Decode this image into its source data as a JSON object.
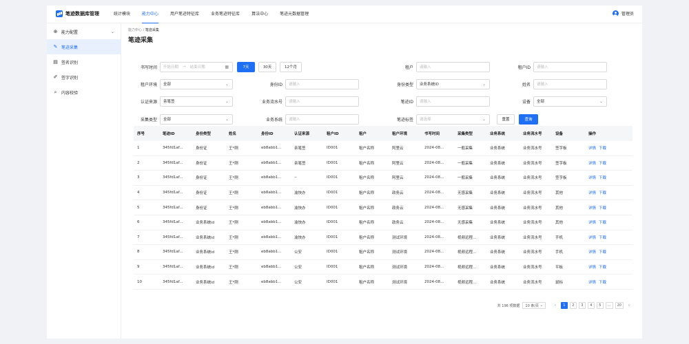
{
  "app": {
    "title": "笔迹数据库管理"
  },
  "nav": [
    {
      "label": "统计模块",
      "active": false
    },
    {
      "label": "能力中心",
      "active": true
    },
    {
      "label": "用户笔迹特征库",
      "active": false
    },
    {
      "label": "业务笔迹特征库",
      "active": false
    },
    {
      "label": "算法中心",
      "active": false
    },
    {
      "label": "笔迹元数据管理",
      "active": false
    }
  ],
  "user": {
    "name": "管理员"
  },
  "sidebar": {
    "group": {
      "label": "能力配置",
      "icon": "settings-icon"
    },
    "items": [
      {
        "label": "笔迹采集",
        "icon": "edit-doc-icon",
        "active": true
      },
      {
        "label": "签名识别",
        "icon": "document-icon",
        "active": false
      },
      {
        "label": "签字识别",
        "icon": "pen-icon",
        "active": false
      },
      {
        "label": "内容校验",
        "icon": "search-icon",
        "active": false
      }
    ]
  },
  "breadcrumb": {
    "parent": "能力中心",
    "sep": " / ",
    "current": "笔迹采集"
  },
  "page_title": "笔迹采集",
  "filters": {
    "write_time": {
      "label": "书写时间",
      "start_ph": "开始日期",
      "sep": "→",
      "end_ph": "结束日期"
    },
    "quick": [
      "7天",
      "30天",
      "12个月"
    ],
    "tenant": {
      "label": "租户",
      "ph": "请输入"
    },
    "tenant_id": {
      "label": "租户ID",
      "ph": "请输入"
    },
    "tenant_env": {
      "label": "租户环境",
      "value": "全部"
    },
    "id_type": {
      "label": "身份类型",
      "value": "业务系统ID"
    },
    "id_no": {
      "label": "身份ID",
      "ph": "请输入"
    },
    "name": {
      "label": "姓名",
      "ph": "请输入"
    },
    "auth_source": {
      "label": "认证来源",
      "value": "亲笔签"
    },
    "biz_serial": {
      "label": "业务流水号",
      "ph": "请输入"
    },
    "stroke_id": {
      "label": "笔迹ID",
      "ph": "请输入"
    },
    "device": {
      "label": "设备",
      "value": "全部"
    },
    "collect_type": {
      "label": "采集类型",
      "value": "全部"
    },
    "biz_system": {
      "label": "业务系统",
      "ph": "请输入"
    },
    "stroke_tag": {
      "label": "笔迹标签",
      "ph": "请选择"
    },
    "reset": "重置",
    "query": "查询"
  },
  "table": {
    "columns": [
      "序号",
      "笔迹ID",
      "身份类型",
      "姓名",
      "身份ID",
      "认证来源",
      "租户ID",
      "租户",
      "租户环境",
      "书写时间",
      "采集类型",
      "业务系统",
      "业务流水号",
      "设备",
      "操作"
    ],
    "rows": [
      [
        "1",
        "345fd1af...",
        "身份证",
        "王*刚",
        "eb8abb1...",
        "亲笔签",
        "ID001",
        "租户名称",
        "阿里云",
        "2024-08...",
        "一般采集",
        "业务系统",
        "业务流水号",
        "签字板"
      ],
      [
        "2",
        "345fd1af...",
        "身份证",
        "王*刚",
        "eb8abb1...",
        "亲笔签",
        "ID001",
        "租户名称",
        "阿里云",
        "2024-08...",
        "一般采集",
        "业务系统",
        "业务流水号",
        "签字板"
      ],
      [
        "3",
        "345fd1af...",
        "身份证",
        "王*刚",
        "eb8abb1...",
        "--",
        "ID001",
        "租户名称",
        "阿里云",
        "2024-08...",
        "一般采集",
        "业务系统",
        "业务流水号",
        "签字板"
      ],
      [
        "4",
        "345fd1af...",
        "身份证",
        "王*刚",
        "eb8abb1...",
        "渝快办",
        "ID001",
        "租户名称",
        "政务云",
        "2024-08...",
        "无感采集",
        "业务系统",
        "业务流水号",
        "其他"
      ],
      [
        "5",
        "345fd1af...",
        "身份证",
        "王*刚",
        "eb8abb1...",
        "渝快办",
        "ID001",
        "租户名称",
        "政务云",
        "2024-08...",
        "无感采集",
        "业务系统",
        "业务流水号",
        "其他"
      ],
      [
        "6",
        "345fd1af...",
        "业务系统id",
        "王*刚",
        "eb8abb1...",
        "渝快办",
        "ID001",
        "租户名称",
        "政务云",
        "2024-08...",
        "无感采集",
        "业务系统",
        "业务流水号",
        "其他"
      ],
      [
        "7",
        "345fd1af...",
        "业务系统id",
        "王*刚",
        "eb8abb1...",
        "渝快办",
        "ID001",
        "租户名称",
        "测试环境",
        "2024-08...",
        "视频远程...",
        "业务系统",
        "业务流水号",
        "手机"
      ],
      [
        "8",
        "345fd1af...",
        "业务系统id",
        "王*刚",
        "eb8abb1...",
        "公安",
        "ID001",
        "租户名称",
        "测试环境",
        "2024-08...",
        "视频远程...",
        "业务系统",
        "业务流水号",
        "手机"
      ],
      [
        "9",
        "345fd1af...",
        "业务系统id",
        "王*刚",
        "eb8abb1...",
        "公安",
        "ID001",
        "租户名称",
        "测试环境",
        "2024-08...",
        "视频远程...",
        "业务系统",
        "业务流水号",
        "平板"
      ],
      [
        "10",
        "345fd1af...",
        "业务系统id",
        "王*刚",
        "eb8abb1...",
        "公安",
        "ID001",
        "租户名称",
        "测试环境",
        "2024-08...",
        "视频远程...",
        "业务系统",
        "业务流水号",
        "鼠标"
      ]
    ],
    "ops": {
      "detail": "详情",
      "download": "下载"
    }
  },
  "pagination": {
    "total": "共 196 项数据",
    "page_size": "10 条/页",
    "prev": "‹",
    "pages": [
      "1",
      "2",
      "3",
      "4",
      "5",
      "...",
      "20"
    ],
    "current": "1",
    "next": "›"
  },
  "colors": {
    "primary": "#1f6ff5",
    "sidebar_active_bg": "#e8f0fe"
  }
}
